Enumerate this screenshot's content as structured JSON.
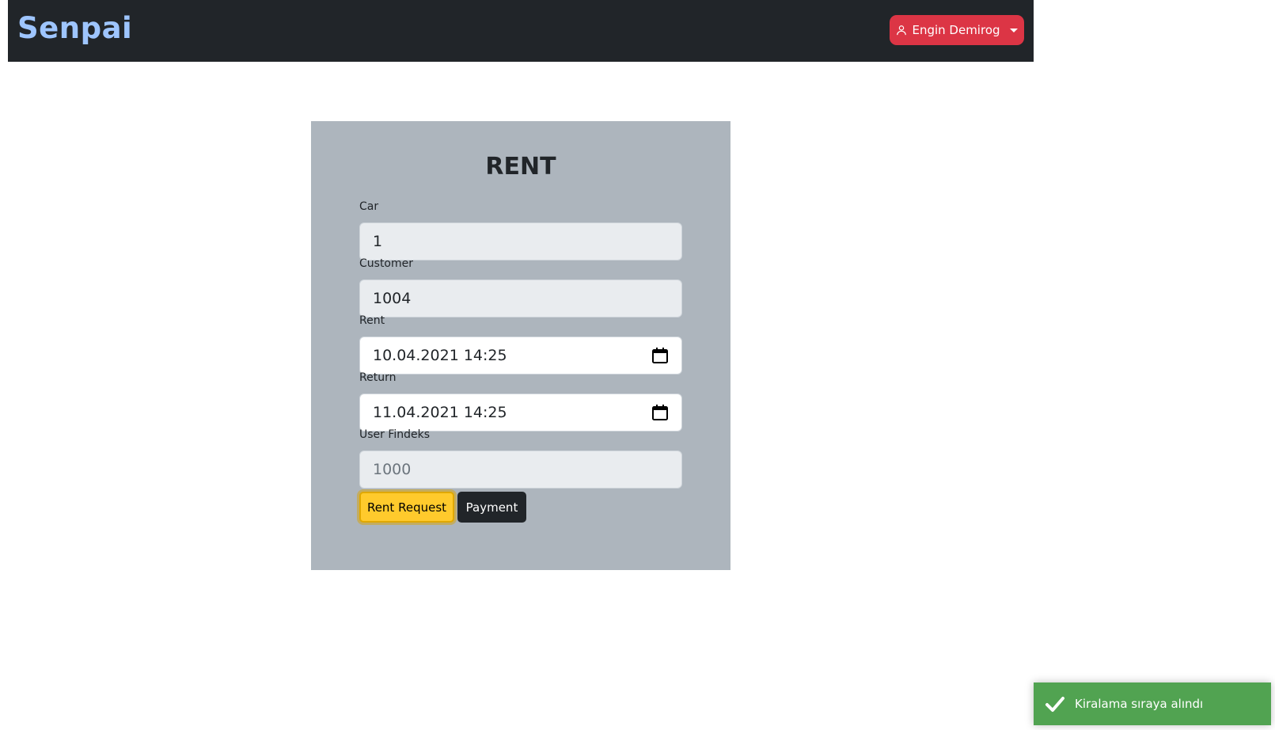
{
  "navbar": {
    "brand": "Senpai",
    "user_menu": {
      "label": "Engin Demirog",
      "icon": "person-icon",
      "dropdown_icon": "caret-down-icon"
    },
    "colors": {
      "background": "#212529",
      "brand": "#9ec5fe",
      "user_button": "#dc3545"
    }
  },
  "form": {
    "title": "RENT",
    "fields": [
      {
        "label": "Car",
        "value": "1",
        "readonly": true
      },
      {
        "label": "Customer",
        "value": "1004",
        "readonly": true
      },
      {
        "label": "Rent",
        "value": "10.04.2021 14:25",
        "readonly": false,
        "icon": "calendar-icon"
      },
      {
        "label": "Return",
        "value": "11.04.2021 14:25",
        "readonly": false,
        "icon": "calendar-icon"
      },
      {
        "label": "User Findeks",
        "placeholder": "1000",
        "readonly": true
      }
    ],
    "buttons": {
      "rent_request": "Rent Request",
      "payment": "Payment"
    },
    "colors": {
      "card_background": "#adb5bd",
      "rent_request": "#ffca2c",
      "payment": "#212529"
    }
  },
  "toast": {
    "message": "Kiralama sıraya alındı",
    "icon": "check-icon",
    "color": "#51a351"
  }
}
